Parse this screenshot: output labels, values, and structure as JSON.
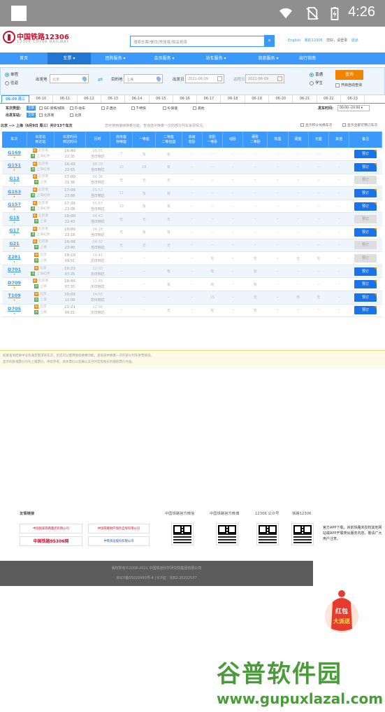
{
  "status_bar": {
    "time": "4:26"
  },
  "header": {
    "logo_title": "中国铁路12306",
    "logo_sub": "12306 CHINA RAILWAY",
    "search_placeholder": "搜索车票/餐饮/常旅客/相关规章",
    "links": [
      "English",
      "我的12306",
      "您好，请登录"
    ],
    "link_sep": "退出"
  },
  "nav": [
    "首页",
    "车票",
    "团购服务",
    "会员服务",
    "站车服务",
    "商旅服务",
    "出行指南"
  ],
  "query": {
    "trip_oneway": "单程",
    "trip_round": "往返",
    "from_label": "出发地",
    "from_value": "北京",
    "to_label": "目的地",
    "to_value": "上海",
    "depart_label": "出发日",
    "depart_value": "2021-06-09",
    "return_label": "返程日",
    "return_value": "2021-06-09",
    "normal": "普通",
    "student": "学生",
    "query_button": "查询",
    "auto_query": "开启自动查询"
  },
  "dates": [
    "06-09 周三",
    "06-10",
    "06-11",
    "06-12",
    "06-13",
    "06-14",
    "06-15",
    "06-16",
    "06-17",
    "06-18",
    "06-19",
    "06-20",
    "06-21",
    "06-22",
    "06-23"
  ],
  "filters": {
    "type_label": "车次类型:",
    "station_label": "出发车站:",
    "all": "全部",
    "types": [
      "GC-高铁/城际",
      "D-动车",
      "Z-直达",
      "T-特快",
      "K-快速",
      "其他"
    ],
    "stations": [
      "北京南",
      "北京"
    ],
    "time_label": "发车时间:",
    "time_value": "00:00--24:00"
  },
  "summary": {
    "route": "北京 --> 上海（6月9日 周三）共计13个车次",
    "tip": "您可使用接续换乘功能，查询途中换乘一次的部分列车余票情况。",
    "opt1": "显示积分兑换车次",
    "opt2": "显示全部可预订车次"
  },
  "table": {
    "headers": [
      "车次",
      "出发站\n到达站",
      "出发时间\n到达时间",
      "历时",
      "商务座\n特等座",
      "一等座",
      "二等座\n二等包座",
      "高级\n软卧",
      "软卧\n一等卧",
      "动卧",
      "硬卧\n二等卧",
      "软座",
      "硬座",
      "无座",
      "其他",
      "备注"
    ],
    "rows": [
      {
        "no": "G169",
        "from": "北京南",
        "to": "上海虹桥",
        "dep": "16:40",
        "arr": "22:35",
        "dur": "05:55",
        "day": "当日到达",
        "c": [
          "7",
          "有",
          "有",
          "--",
          "--",
          "--",
          "--",
          "--",
          "--",
          "--",
          "--"
        ],
        "book": "预订"
      },
      {
        "no": "G151",
        "from": "北京南",
        "to": "上海虹桥",
        "dep": "16:45",
        "arr": "22:55",
        "dur": "06:10",
        "day": "当日到达",
        "c": [
          "10",
          "18",
          "有",
          "--",
          "--",
          "--",
          "--",
          "--",
          "--",
          "--",
          "--"
        ],
        "book": "预订"
      },
      {
        "no": "G13",
        "from": "北京南",
        "to": "上海",
        "dep": "17:00",
        "arr": "21:36",
        "dur": "04:36",
        "day": "当日到达",
        "c": [
          "无",
          "无",
          "无",
          "--",
          "--",
          "--",
          "--",
          "--",
          "--",
          "--",
          "--"
        ],
        "book": "预订"
      },
      {
        "no": "G153",
        "from": "北京南",
        "to": "上海虹桥",
        "dep": "17:06",
        "arr": "23:08",
        "dur": "05:52",
        "day": "当日到达",
        "c": [
          "11",
          "有",
          "有",
          "--",
          "--",
          "--",
          "--",
          "--",
          "--",
          "--",
          "--"
        ],
        "book": "预订"
      },
      {
        "no": "G157",
        "from": "北京南",
        "to": "上海虹桥",
        "dep": "17:36",
        "arr": "23:08",
        "dur": "05:57",
        "day": "当日到达",
        "c": [
          "10",
          "有",
          "有",
          "--",
          "--",
          "--",
          "--",
          "--",
          "--",
          "--",
          "--"
        ],
        "book": "预订"
      },
      {
        "no": "G15",
        "from": "北京南",
        "to": "上海",
        "dep": "18:00",
        "arr": "22:43",
        "dur": "04:43",
        "day": "当日到达",
        "c": [
          "无",
          "无",
          "无",
          "--",
          "--",
          "--",
          "--",
          "--",
          "--",
          "--",
          "--"
        ],
        "book": "预订"
      },
      {
        "no": "G17",
        "from": "北京南",
        "to": "上海虹桥",
        "dep": "19:00",
        "arr": "23:18",
        "dur": "04:18",
        "day": "当日到达",
        "c": [
          "无",
          "有",
          "有",
          "--",
          "--",
          "--",
          "--",
          "--",
          "--",
          "--",
          "--"
        ],
        "book": "预订"
      },
      {
        "no": "G21",
        "from": "北京南",
        "to": "上海",
        "dep": "19:08",
        "arr": "23:40",
        "dur": "04:32",
        "day": "当日到达",
        "c": [
          "无",
          "无",
          "无",
          "--",
          "--",
          "--",
          "--",
          "--",
          "--",
          "--",
          "--"
        ],
        "book": "预订"
      },
      {
        "no": "Z281",
        "from": "北京",
        "to": "上海",
        "dep": "19:10",
        "arr": "09:51",
        "dur": "14:41",
        "day": "次日到达",
        "c": [
          "--",
          "--",
          "--",
          "--",
          "无",
          "--",
          "无",
          "--",
          "无",
          "无",
          "--"
        ],
        "book": "预订"
      },
      {
        "no": "D701",
        "from": "北京",
        "to": "上海虹桥",
        "dep": "19:22",
        "arr": "07:25",
        "dur": "12:03",
        "day": "次日到达",
        "c": [
          "--",
          "--",
          "有",
          "--",
          "有",
          "--",
          "有",
          "--",
          "--",
          "--",
          "--"
        ],
        "book": "预订"
      },
      {
        "no": "D709",
        "from": "北京南",
        "to": "上海",
        "dep": "19:46",
        "arr": "07:35",
        "dur": "11:49",
        "day": "次日到达",
        "c": [
          "--",
          "--",
          "有",
          "--",
          "有",
          "--",
          "有",
          "--",
          "--",
          "--",
          "--"
        ],
        "book": "预订"
      },
      {
        "no": "T109",
        "from": "北京",
        "to": "上海",
        "dep": "20:05",
        "arr": "11:00",
        "dur": "14:55",
        "day": "次日到达",
        "c": [
          "--",
          "--",
          "--",
          "--",
          "15",
          "--",
          "无",
          "--",
          "有",
          "无",
          "--"
        ],
        "book": "预订"
      },
      {
        "no": "D705",
        "from": "北京",
        "to": "上海",
        "dep": "21:21",
        "arr": "09:21",
        "dur": "12:00",
        "day": "次日到达",
        "c": [
          "--",
          "--",
          "无",
          "--",
          "有",
          "--",
          "有",
          "--",
          "--",
          "--",
          "--"
        ],
        "book": "预订"
      }
    ]
  },
  "note": {
    "line1": "如果查询结果中没有满足需求的车次，您还可以使用接续换乘功能，查询途中换乘一次的部分列车余票情况。",
    "line2": "显示的卧铺票价均为上铺票价，供您参考。具体票价以您确认支付时实际购买的铺别票价为准。"
  },
  "footer": {
    "friends": "友情链接",
    "links": [
      "中国国家铁路集团有限公司",
      "中国铁路财产保险自保有限公司",
      "中国铁路95306网",
      "中铁快运股份有限公司"
    ],
    "qrs": [
      "中国铁路官方微信",
      "中国铁路官方微博",
      "12306 公众号",
      "铁路12306"
    ],
    "copyright": "版权所有©2008-2021   中国铁道科学研究院集团有限公司",
    "icp": "京ICP备05020493号-4  |  ICP证：京B2-20202537"
  },
  "side_tip": "官方APP下载，目前铁路未授权其他网站或APP开展类似服务内容，敬请广大用户注意。",
  "redpack": {
    "line1": "红包",
    "line2": "大派送"
  },
  "watermark": {
    "title": "谷普软件园",
    "url": "www.gupuxlazal.com"
  }
}
